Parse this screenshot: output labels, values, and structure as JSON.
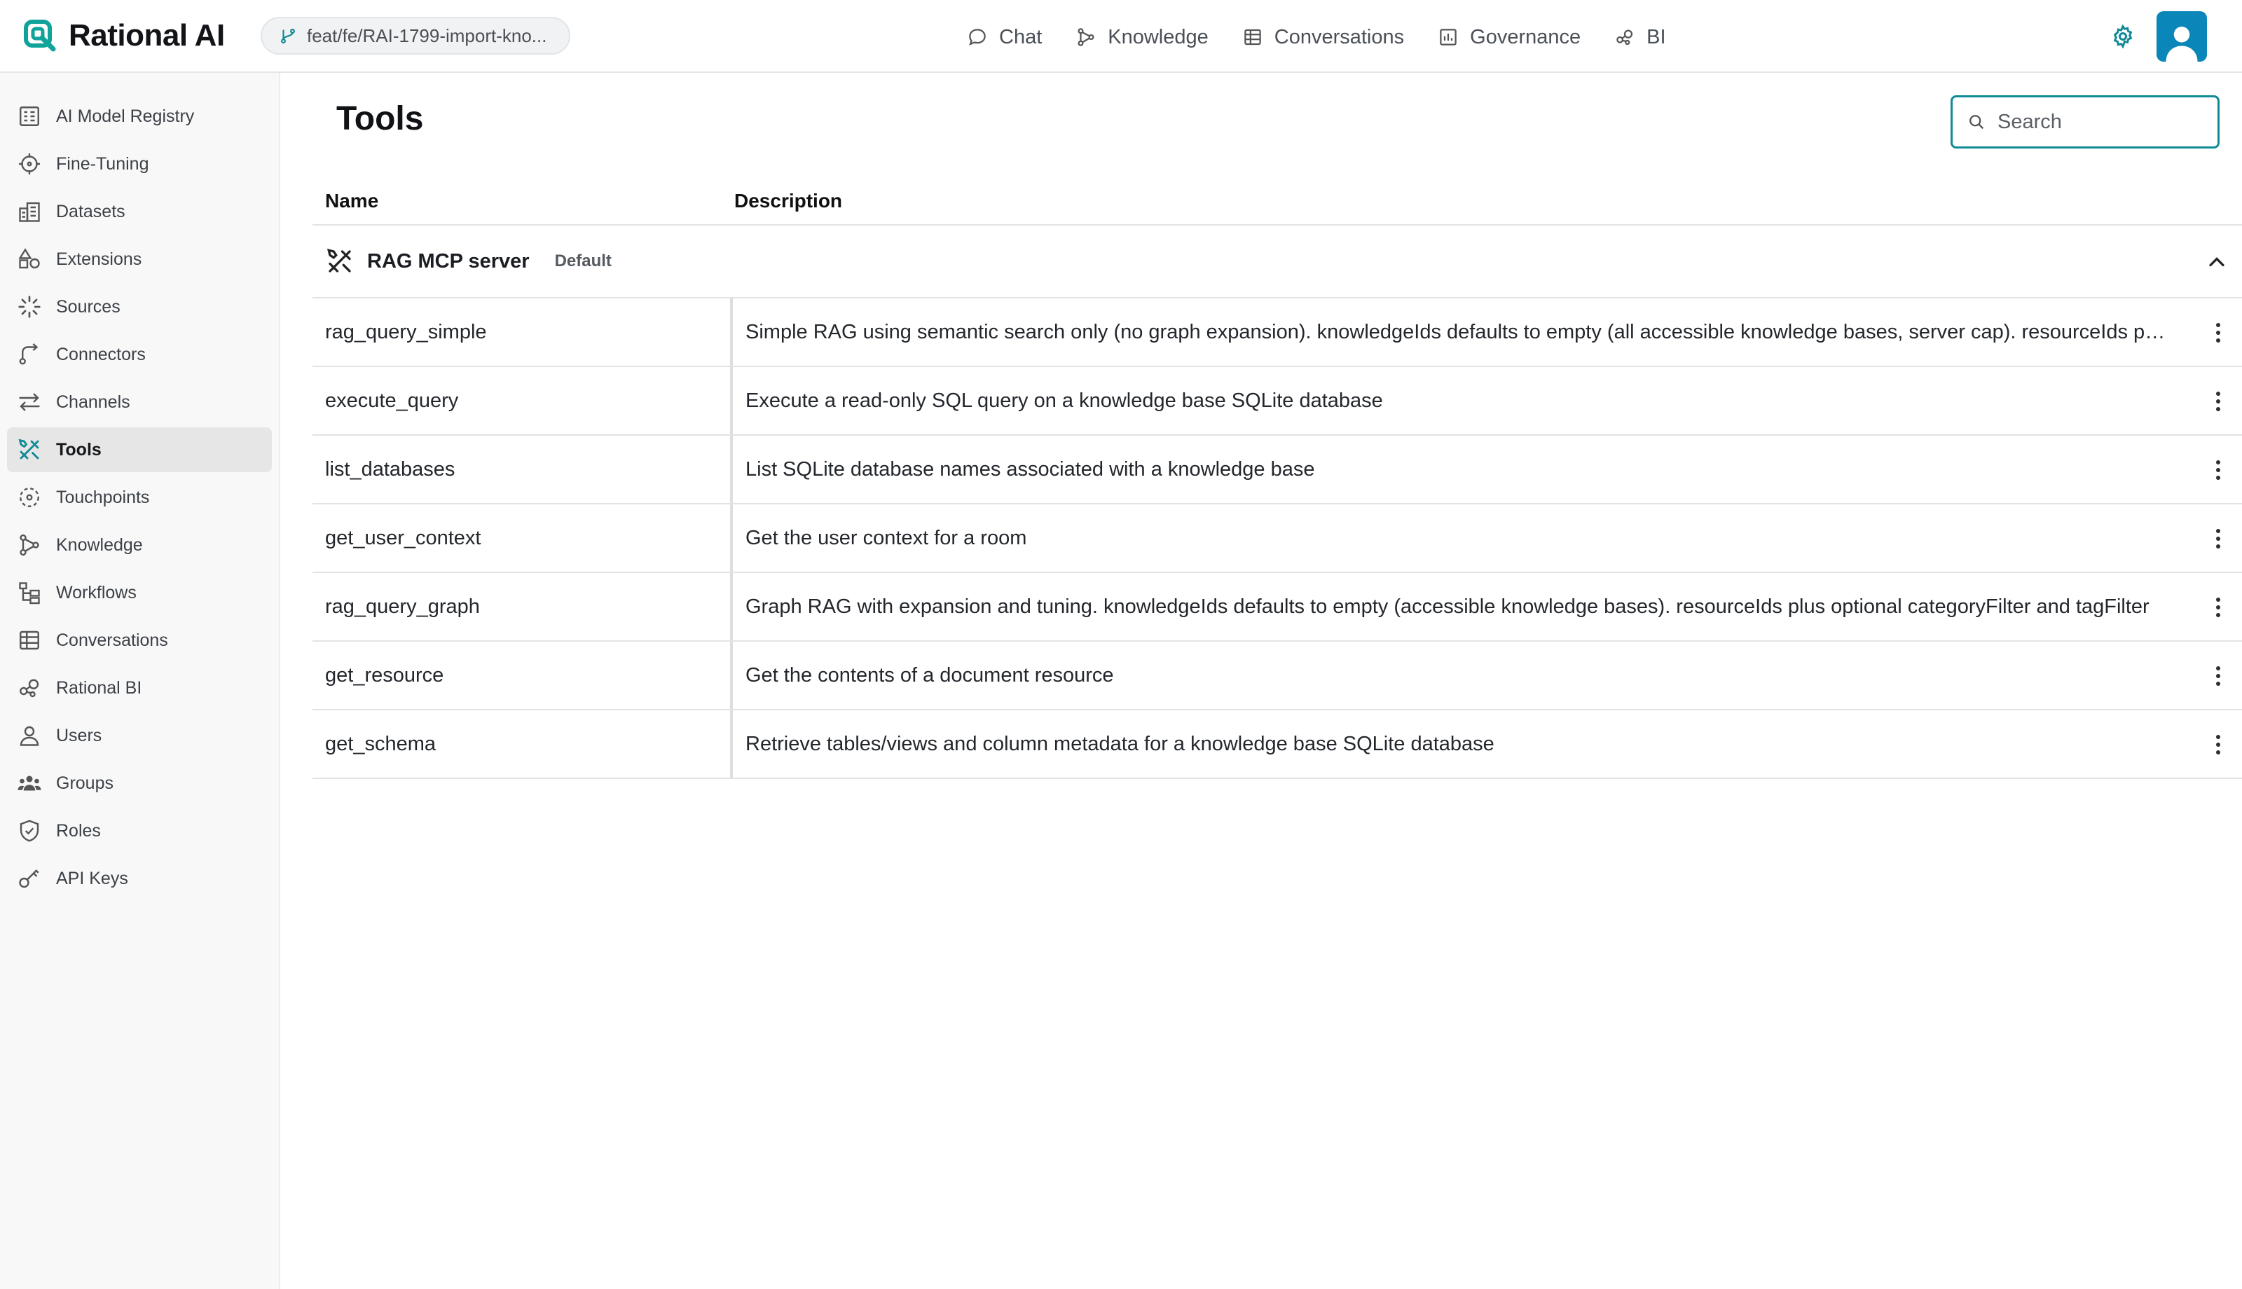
{
  "app": {
    "name": "Rational AI",
    "branch": "feat/fe/RAI-1799-import-kno..."
  },
  "topnav": [
    {
      "label": "Chat",
      "icon": "chat-bubble-icon"
    },
    {
      "label": "Knowledge",
      "icon": "knowledge-graph-icon"
    },
    {
      "label": "Conversations",
      "icon": "table-icon"
    },
    {
      "label": "Governance",
      "icon": "bar-chart-icon"
    },
    {
      "label": "BI",
      "icon": "bi-nodes-icon"
    }
  ],
  "sidebar": {
    "items": [
      {
        "label": "AI Model Registry",
        "icon": "registry-icon"
      },
      {
        "label": "Fine-Tuning",
        "icon": "crosshair-icon"
      },
      {
        "label": "Datasets",
        "icon": "datasets-icon"
      },
      {
        "label": "Extensions",
        "icon": "shapes-icon"
      },
      {
        "label": "Sources",
        "icon": "loader-icon"
      },
      {
        "label": "Connectors",
        "icon": "connector-icon"
      },
      {
        "label": "Channels",
        "icon": "arrows-left-right-icon"
      },
      {
        "label": "Tools",
        "icon": "tools-icon",
        "active": true
      },
      {
        "label": "Touchpoints",
        "icon": "dashed-circle-icon"
      },
      {
        "label": "Knowledge",
        "icon": "knowledge-graph-icon"
      },
      {
        "label": "Workflows",
        "icon": "workflow-icon"
      },
      {
        "label": "Conversations",
        "icon": "table-icon"
      },
      {
        "label": "Rational BI",
        "icon": "bi-nodes-icon"
      },
      {
        "label": "Users",
        "icon": "user-icon"
      },
      {
        "label": "Groups",
        "icon": "users-group-icon"
      },
      {
        "label": "Roles",
        "icon": "shield-check-icon"
      },
      {
        "label": "API Keys",
        "icon": "key-icon"
      }
    ]
  },
  "main": {
    "title": "Tools",
    "search": {
      "placeholder": "Search",
      "value": ""
    },
    "table": {
      "columns": [
        "Name",
        "Description"
      ],
      "group": {
        "name": "RAG MCP server",
        "badge": "Default",
        "expanded": true
      },
      "rows": [
        {
          "name": "rag_query_simple",
          "description": "Simple RAG using semantic search only (no graph expansion). knowledgeIds defaults to empty (all accessible knowledge bases, server cap). resourceIds plus optional categoryFilter and tagFilter"
        },
        {
          "name": "execute_query",
          "description": "Execute a read-only SQL query on a knowledge base SQLite database"
        },
        {
          "name": "list_databases",
          "description": "List SQLite database names associated with a knowledge base"
        },
        {
          "name": "get_user_context",
          "description": "Get the user context for a room"
        },
        {
          "name": "rag_query_graph",
          "description": "Graph RAG with expansion and tuning. knowledgeIds defaults to empty (accessible knowledge bases). resourceIds plus optional categoryFilter and tagFilter"
        },
        {
          "name": "get_resource",
          "description": "Get the contents of a document resource"
        },
        {
          "name": "get_schema",
          "description": "Retrieve tables/views and column metadata for a knowledge base SQLite database"
        }
      ]
    }
  },
  "colors": {
    "accent": "#0f8a96",
    "logo": "#0fa39a",
    "avatar": "#0a86b8",
    "sidebar_active_bg": "#e6e6e6"
  }
}
